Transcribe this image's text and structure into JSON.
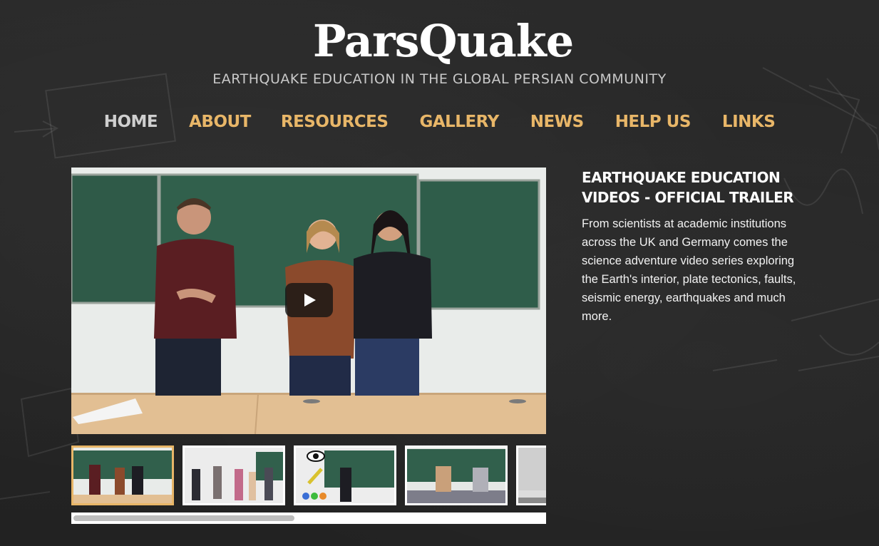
{
  "header": {
    "logo": "ParsQuake",
    "tagline": "EARTHQUAKE EDUCATION IN THE GLOBAL PERSIAN COMMUNITY"
  },
  "nav": {
    "items": [
      {
        "label": "HOME"
      },
      {
        "label": "ABOUT"
      },
      {
        "label": "RESOURCES"
      },
      {
        "label": "GALLERY"
      },
      {
        "label": "NEWS"
      },
      {
        "label": "HELP US"
      },
      {
        "label": "LINKS"
      }
    ]
  },
  "feature": {
    "title": "EARTHQUAKE EDUCATION VIDEOS - OFFICIAL TRAILER",
    "description": "From scientists at academic institutions across the UK and Germany comes the science adventure video series exploring the Earth's interior, plate tectonics, faults, seismic energy, earthquakes and much more."
  },
  "colors": {
    "background": "#262626",
    "nav_link": "#e8b668",
    "nav_active": "#cfcfcf",
    "text": "#ffffff",
    "thumb_selected_border": "#e8b668"
  },
  "icons": {
    "play": "play-icon"
  },
  "gallery": {
    "thumbnail_count": 5,
    "selected_index": 0
  }
}
